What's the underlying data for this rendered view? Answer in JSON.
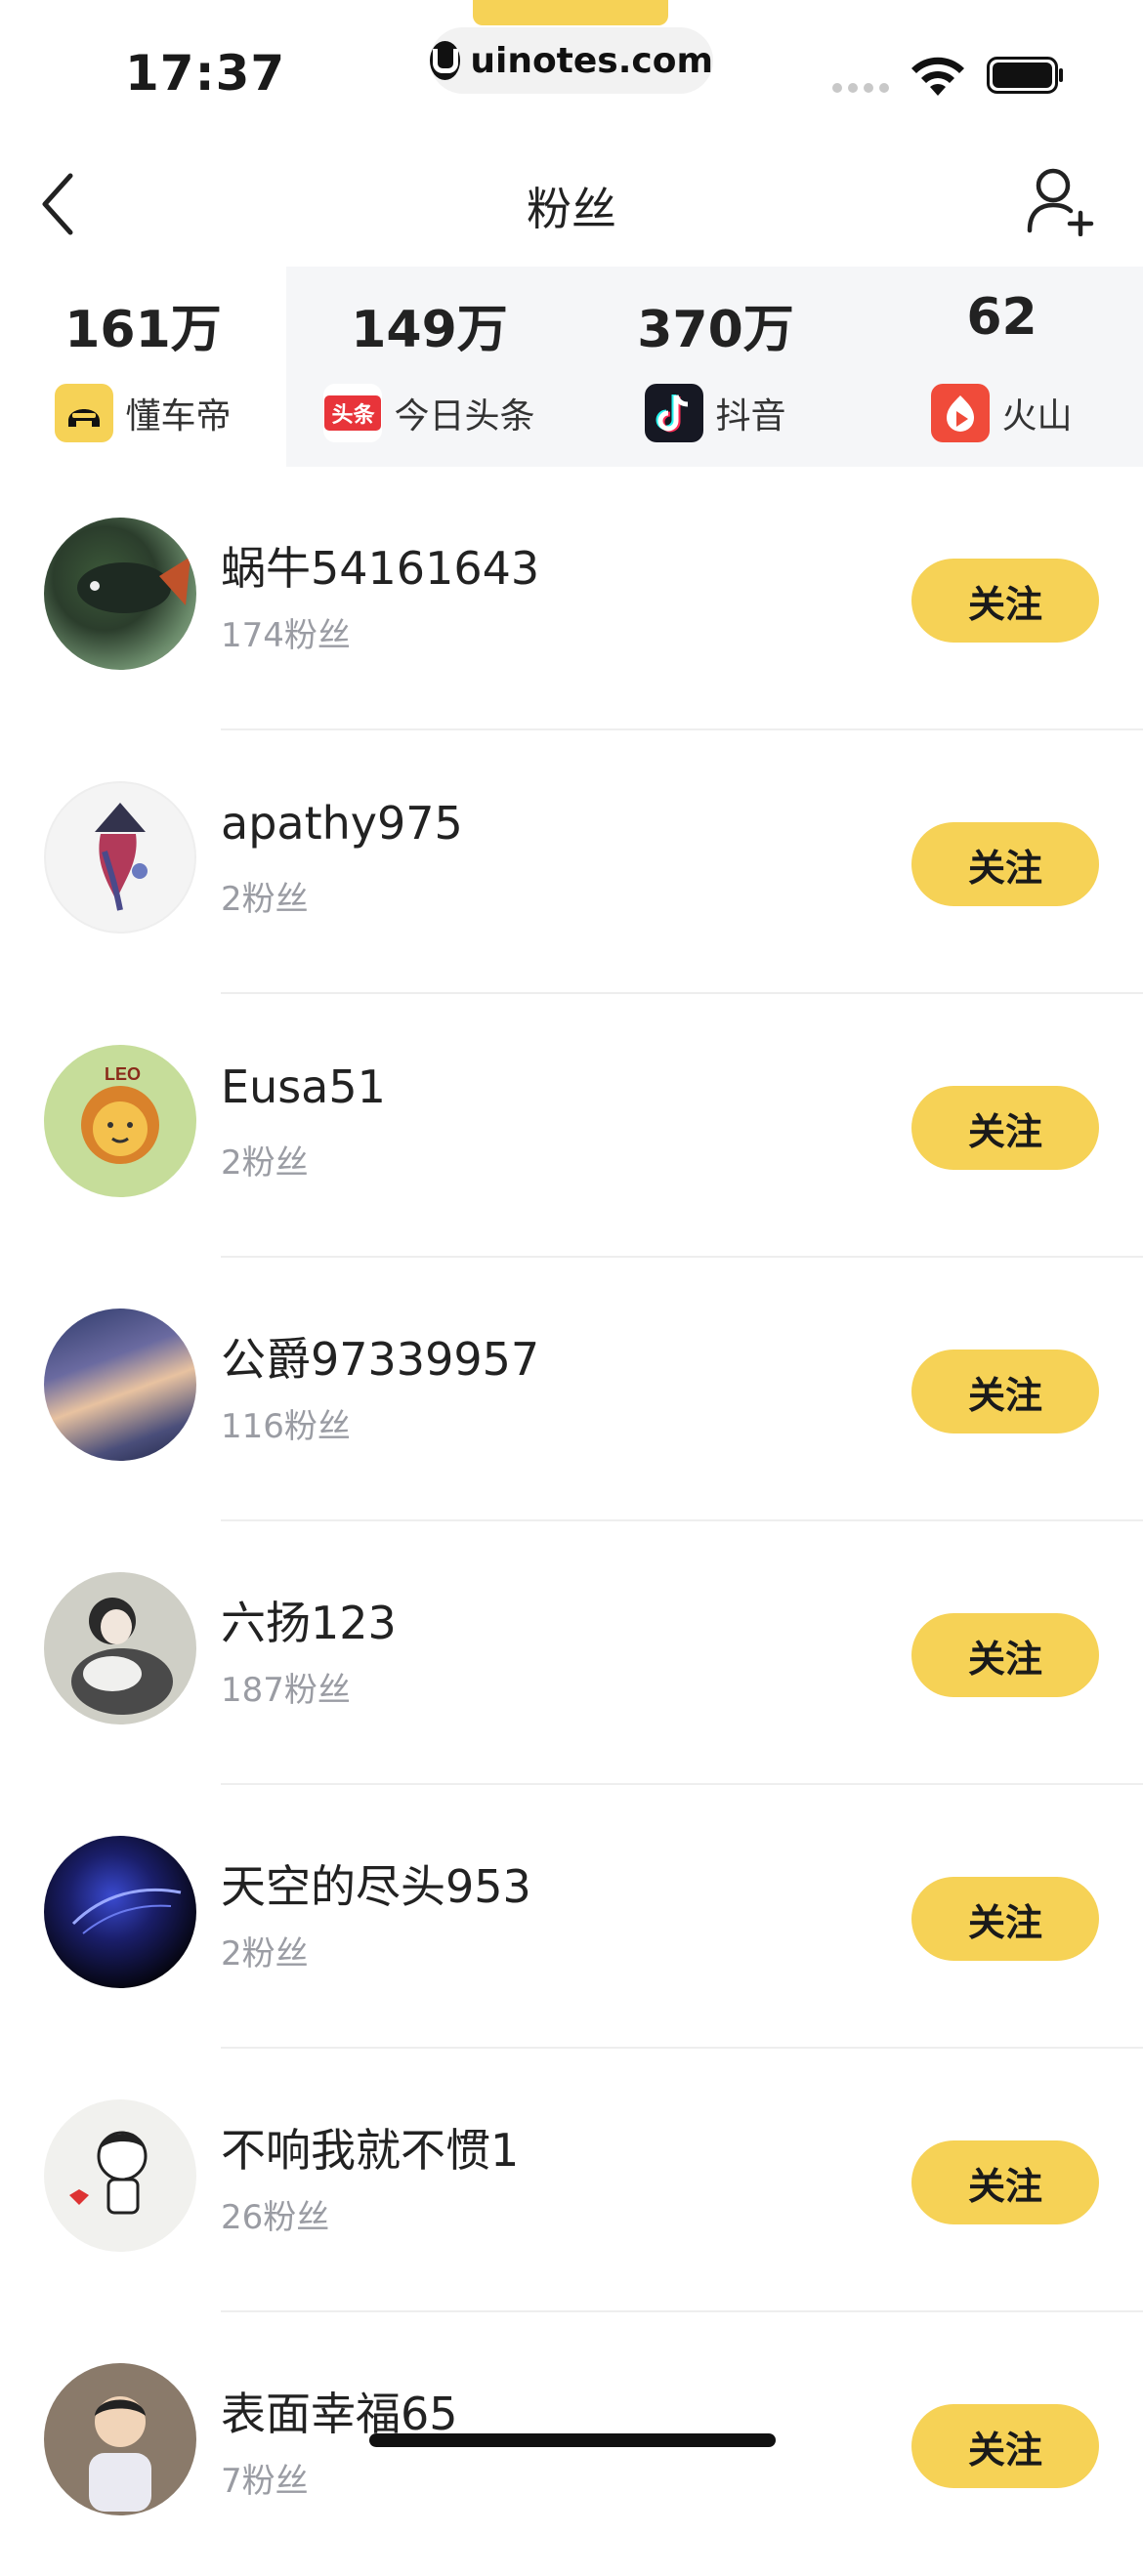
{
  "status_bar": {
    "time": "17:37",
    "url": "uinotes.com"
  },
  "nav": {
    "title": "粉丝"
  },
  "colors": {
    "accent": "#f6d256",
    "muted": "#9a9ca3"
  },
  "platforms": [
    {
      "value": "161万",
      "label": "懂车帝",
      "icon": "dongchedi-icon",
      "active": true
    },
    {
      "value": "149万",
      "label": "今日头条",
      "icon": "toutiao-icon",
      "active": false
    },
    {
      "value": "370万",
      "label": "抖音",
      "icon": "douyin-icon",
      "active": false
    },
    {
      "value": "62",
      "label": "火山",
      "icon": "huoshan-icon",
      "active": false
    }
  ],
  "follow_label": "关注",
  "fans": [
    {
      "name": "蜗牛54161643",
      "fans": "174粉丝"
    },
    {
      "name": "apathy975",
      "fans": "2粉丝"
    },
    {
      "name": "Eusa51",
      "fans": "2粉丝"
    },
    {
      "name": "公爵97339957",
      "fans": "116粉丝"
    },
    {
      "name": "六扬123",
      "fans": "187粉丝"
    },
    {
      "name": "天空的尽头953",
      "fans": "2粉丝"
    },
    {
      "name": "不响我就不惯1",
      "fans": "26粉丝"
    },
    {
      "name": "表面幸福65",
      "fans": "7粉丝"
    }
  ]
}
